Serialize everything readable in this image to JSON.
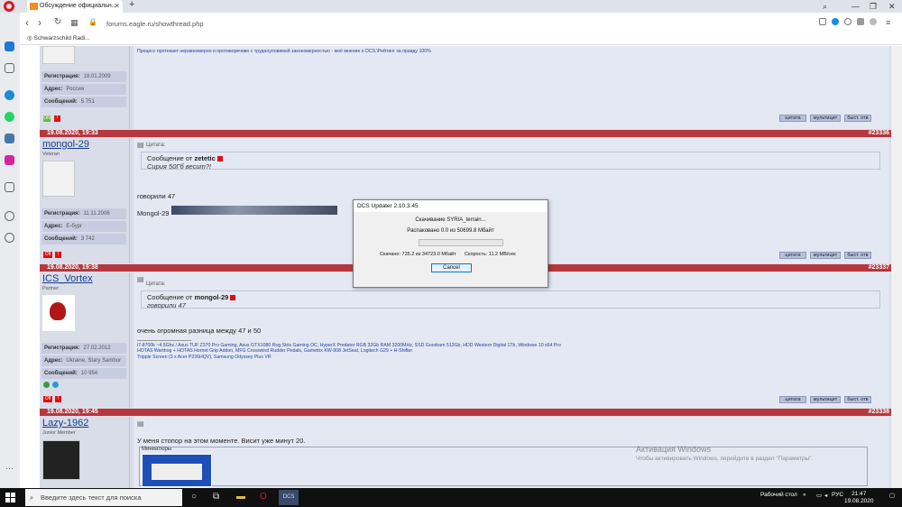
{
  "browser": {
    "tab_title": "Обсуждение официальн...",
    "url": "forums.eagle.ru/showthread.php",
    "bookmark": "Schwarzschild Radi..."
  },
  "posts": [
    {
      "top_sig": "Процесс протекает неравномерно и противоречиво с трудноуловимой закономерностью - моё мнение о DCS.\\Рейтинг за правду 100%",
      "stats": {
        "reg_label": "Регистрация:",
        "reg": "18.01.2009",
        "addr_label": "Адрес:",
        "addr": "Россия",
        "msgs_label": "Сообщений:",
        "msgs": "5 751"
      }
    },
    {
      "date": "19.08.2020, 19:33",
      "number": "#23336",
      "username": "mongol-29",
      "user_title": "Veteran",
      "quote_label": "Цитата:",
      "quote_author_prefix": "Сообщение от",
      "quote_author": "zetetic",
      "quote_text": "Сирия 50Гб весит?!",
      "text": "говорили 47",
      "sig_name": "Mongol-29",
      "stats": {
        "reg_label": "Регистрация:",
        "reg": "11.11.2006",
        "addr_label": "Адрес:",
        "addr": "Е-бург",
        "msgs_label": "Сообщений:",
        "msgs": "3 742"
      }
    },
    {
      "date": "19.08.2020, 19:38",
      "number": "#23337",
      "username": "ICS_Vortex",
      "user_title": "Partner",
      "quote_label": "Цитата:",
      "quote_author_prefix": "Сообщение от",
      "quote_author": "mongol-29",
      "quote_text": "говорили 47",
      "text": "очень огромная разница между 47 и 50",
      "sig_lines": [
        "i7-8700k ~4.5Ghz / Asus TUF Z370 Pro Gaming, Asus GTX1080 Rog Strix Gaming OC, HyperX Predator RGB 32Gb RAM 3200MHz, SSD Goodram 512Gb, HDD Western Digital 1Tb, Windows 10 x64 Pro",
        "HOTAS Warthog + HOTAS Hornet Grip Addon, MFG Crosswind Rudder Pedals, Gametrix KW-908 JetSeat, Logitech G29 + H-Shifter",
        "Tripple Screen (3 x Acer P226HQV), Samsung Odyssey Plus VR"
      ],
      "stats": {
        "reg_label": "Регистрация:",
        "reg": "27.02.2012",
        "addr_label": "Адрес:",
        "addr": "Ukraine, Stary Sambor",
        "msgs_label": "Сообщений:",
        "msgs": "10 954"
      }
    },
    {
      "date": "19.08.2020, 19:45",
      "number": "#23338",
      "username": "Lazy-1962",
      "user_title": "Junior Member",
      "text": "У меня стопор на этом моменте. Висит уже минут 20.",
      "attach_label": "Миниатюры"
    }
  ],
  "buttons": {
    "quote": "цитата",
    "multiquote": "мультицит",
    "fast": "быст. отв"
  },
  "badges": {
    "off": "Off",
    "on": "ON"
  },
  "dialog": {
    "title": "DCS Updater 2.10.3.45",
    "line1": "Скачивание SYRIA_terrain...",
    "line2": "Распаковано 0.0 из 50699.8 Мбайт",
    "downloaded": "Скачано: 735.2 из 34723.0 Мбайт",
    "speed": "Скорость: 11.2 MB/сек",
    "progress": 0.0,
    "cancel": "Cancel"
  },
  "watermark": {
    "title": "Активация Windows",
    "text": "Чтобы активировать Windows, перейдите в раздел \"Параметры\"."
  },
  "taskbar": {
    "search_placeholder": "Введите здесь текст для поиска",
    "desktop": "Рабочий стол",
    "lang": "РУС",
    "time": "21:47",
    "date": "19.08.2020"
  }
}
